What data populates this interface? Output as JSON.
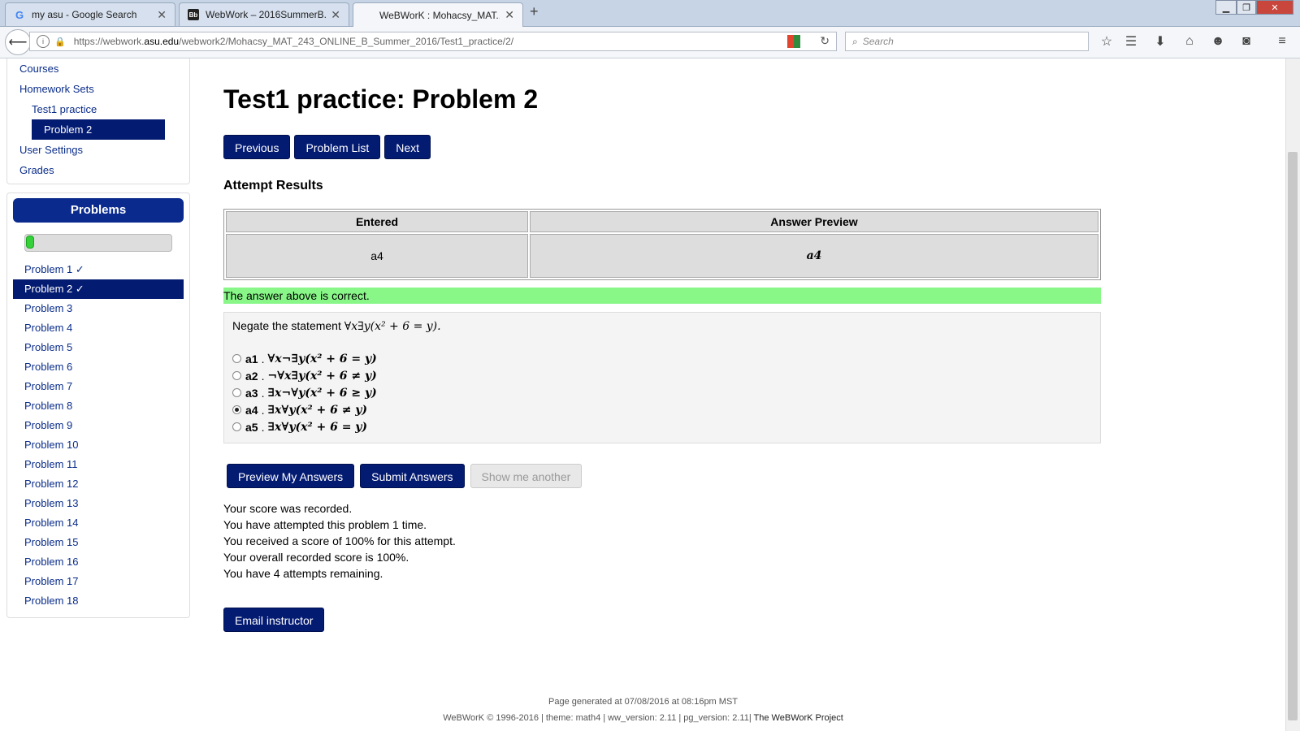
{
  "browser": {
    "tabs": [
      {
        "title": "my asu - Google Search",
        "favicon": "G"
      },
      {
        "title": "WebWork – 2016SummerB...",
        "favicon": "Bb"
      },
      {
        "title": "WeBWorK : Mohacsy_MAT...",
        "favicon": ""
      }
    ],
    "url_prefix": "https://webwork.",
    "url_domain": "asu.edu",
    "url_path": "/webwork2/Mohacsy_MAT_243_ONLINE_B_Summer_2016/Test1_practice/2/",
    "search_placeholder": "Search"
  },
  "sidebar": {
    "links": {
      "courses": "Courses",
      "homework_sets": "Homework Sets",
      "set": "Test1 practice",
      "problem": "Problem 2",
      "user_settings": "User Settings",
      "grades": "Grades"
    },
    "problems_title": "Problems",
    "progress_fraction": 0.056,
    "problems": [
      "Problem 1 ✓",
      "Problem 2 ✓",
      "Problem 3",
      "Problem 4",
      "Problem 5",
      "Problem 6",
      "Problem 7",
      "Problem 8",
      "Problem 9",
      "Problem 10",
      "Problem 11",
      "Problem 12",
      "Problem 13",
      "Problem 14",
      "Problem 15",
      "Problem 16",
      "Problem 17",
      "Problem 18"
    ]
  },
  "main": {
    "title": "Test1 practice: Problem 2",
    "nav_buttons": {
      "previous": "Previous",
      "problem_list": "Problem List",
      "next": "Next"
    },
    "attempt_heading": "Attempt Results",
    "results": {
      "headers": [
        "Entered",
        "Answer Preview"
      ],
      "entered": "a4",
      "preview": "a4"
    },
    "correct_message": "The answer above is correct.",
    "question": {
      "prompt": "Negate the statement",
      "statement": "∀x∃y(x² + 6 = y).",
      "options": [
        {
          "label": "a1",
          "expr": "∀x¬∃y(x² + 6 = y)",
          "checked": false
        },
        {
          "label": "a2",
          "expr": "¬∀x∃y(x² + 6 ≠ y)",
          "checked": false
        },
        {
          "label": "a3",
          "expr": "∃x¬∀y(x² + 6 ≥ y)",
          "checked": false
        },
        {
          "label": "a4",
          "expr": "∃x∀y(x² + 6 ≠ y)",
          "checked": true
        },
        {
          "label": "a5",
          "expr": "∃x∀y(x² + 6 = y)",
          "checked": false
        }
      ]
    },
    "action_buttons": {
      "preview": "Preview My Answers",
      "submit": "Submit Answers",
      "another": "Show me another"
    },
    "score_lines": [
      "Your score was recorded.",
      "You have attempted this problem 1 time.",
      "You received a score of 100% for this attempt.",
      "Your overall recorded score is 100%.",
      "You have 4 attempts remaining."
    ],
    "email_button": "Email instructor"
  },
  "footer": {
    "generated": "Page generated at 07/08/2016 at 08:16pm MST",
    "info": "WeBWorK © 1996-2016 | theme: math4 | ww_version: 2.11 | pg_version: 2.11|",
    "project": "The WeBWorK Project"
  }
}
